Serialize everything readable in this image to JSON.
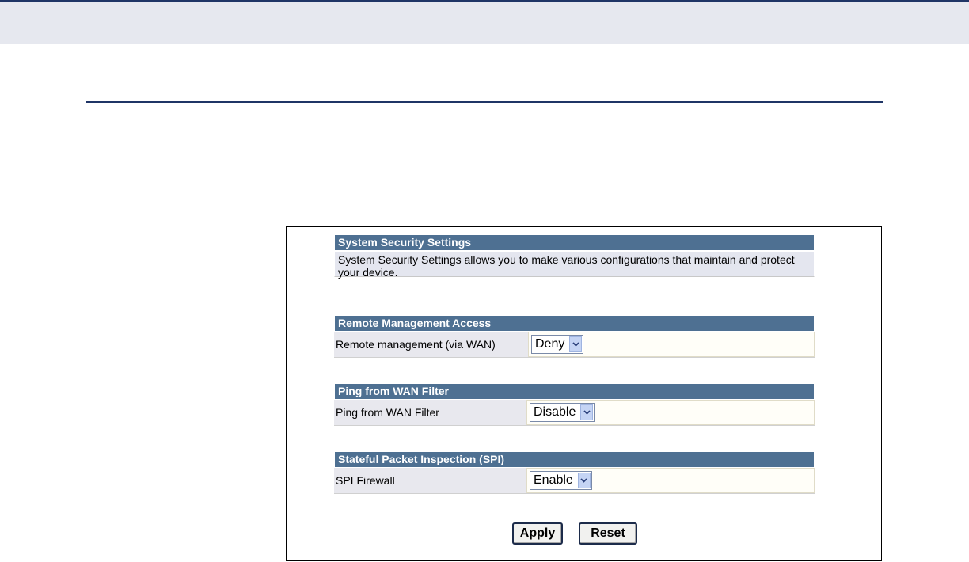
{
  "system_security": {
    "title": "System Security Settings",
    "description": "System Security Settings allows you to make various configurations that maintain and protect your device."
  },
  "remote_management": {
    "title": "Remote Management Access",
    "label": "Remote management (via WAN)",
    "selected": "Deny"
  },
  "ping_filter": {
    "title": "Ping from WAN Filter",
    "label": "Ping from WAN Filter",
    "selected": "Disable"
  },
  "spi": {
    "title": "Stateful Packet Inspection (SPI)",
    "label": "SPI Firewall",
    "selected": "Enable"
  },
  "buttons": {
    "apply": "Apply",
    "reset": "Reset"
  },
  "colors": {
    "header_bg": "#4e7092",
    "rule": "#1f3566",
    "band": "#e6e8ef"
  }
}
